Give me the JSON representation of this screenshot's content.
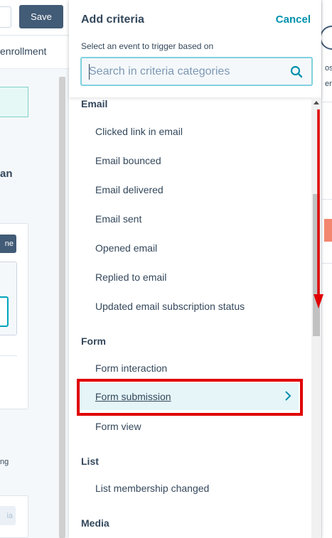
{
  "background": {
    "save_label": "Save",
    "enrollment_text": "enrollment",
    "partial_an": "an",
    "partial_ne": "ne",
    "partial_ng": "ng",
    "partial_ia": "ia",
    "right_t1": "os",
    "right_t2": "ers"
  },
  "panel": {
    "title": "Add criteria",
    "cancel_label": "Cancel",
    "subtitle": "Select an event to trigger based on",
    "search_placeholder": "Search in criteria categories"
  },
  "groups": {
    "email": {
      "label": "Email",
      "items": [
        "Clicked link in email",
        "Email bounced",
        "Email delivered",
        "Email sent",
        "Opened email",
        "Replied to email",
        "Updated email subscription status"
      ]
    },
    "form": {
      "label": "Form",
      "items": [
        "Form interaction",
        "Form submission",
        "Form view"
      ]
    },
    "list": {
      "label": "List",
      "items": [
        "List membership changed"
      ]
    },
    "media": {
      "label": "Media"
    }
  },
  "colors": {
    "accent": "#0091ae",
    "highlight_bg": "#e5f5f8",
    "annotation_red": "#e00000",
    "button_dark": "#425b76"
  }
}
